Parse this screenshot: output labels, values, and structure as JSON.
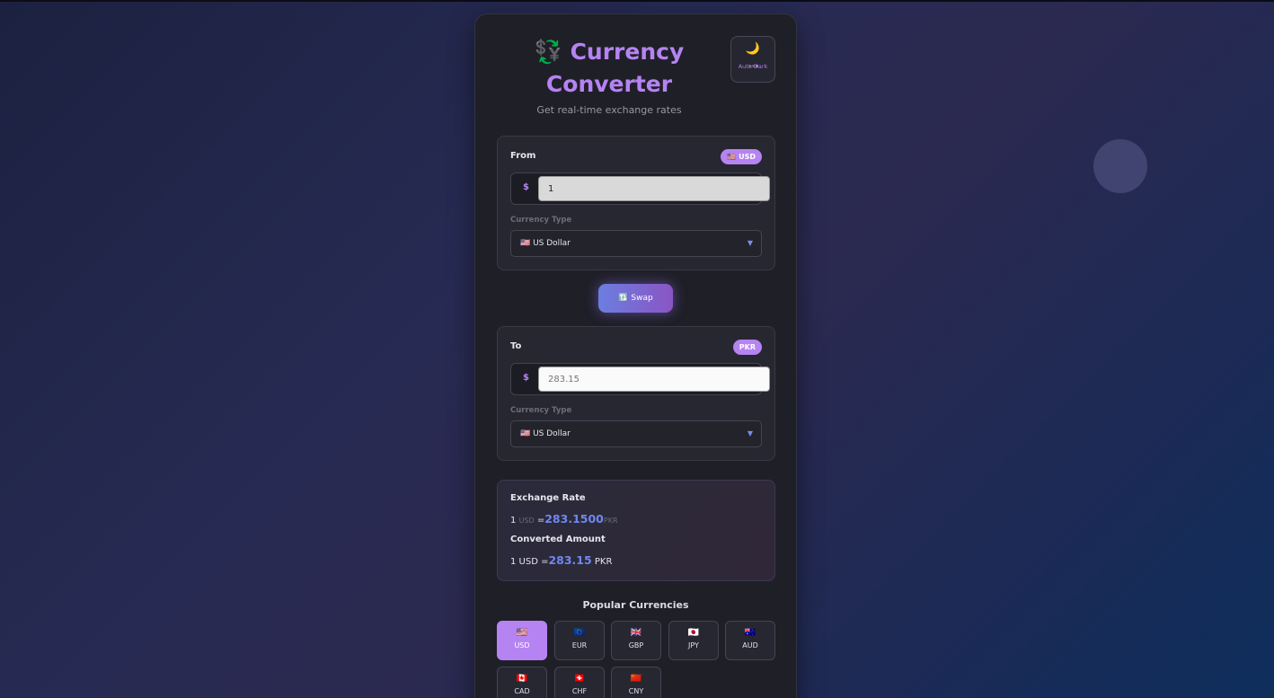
{
  "header": {
    "title_icon": "💱",
    "title_line1": "Currency",
    "title_line2": "Converter",
    "subtitle": "Get real-time exchange rates",
    "dark_toggle": {
      "icon": "🌙",
      "label": "Auto Dark"
    }
  },
  "from": {
    "label": "From",
    "badge": "🇺🇸 USD",
    "symbol": "$",
    "amount": "1",
    "type_label": "Currency Type",
    "selected": "🇺🇸 US Dollar"
  },
  "swap": {
    "label": "🔃 Swap"
  },
  "to": {
    "label": "To",
    "badge": "PKR",
    "symbol": "$",
    "amount": "283.15",
    "type_label": "Currency Type",
    "selected": "🇺🇸 US Dollar"
  },
  "rate": {
    "heading": "Exchange Rate",
    "lhs": "1",
    "from_code": "USD",
    "eq": "=",
    "value": "283.1500",
    "to_code": "PKR"
  },
  "converted": {
    "heading": "Converted Amount",
    "lhs": "1 USD =",
    "value": "283.15",
    "to_code": "PKR"
  },
  "popular": {
    "title": "Popular Currencies",
    "items": [
      {
        "flag": "🇺🇸",
        "code": "USD"
      },
      {
        "flag": "🇪🇺",
        "code": "EUR"
      },
      {
        "flag": "🇬🇧",
        "code": "GBP"
      },
      {
        "flag": "🇯🇵",
        "code": "JPY"
      },
      {
        "flag": "🇦🇺",
        "code": "AUD"
      },
      {
        "flag": "🇨🇦",
        "code": "CAD"
      },
      {
        "flag": "🇨🇭",
        "code": "CHF"
      },
      {
        "flag": "🇨🇳",
        "code": "CNY"
      }
    ]
  },
  "colors": {
    "accent": "#b583f2",
    "highlight": "#6f88f0"
  }
}
